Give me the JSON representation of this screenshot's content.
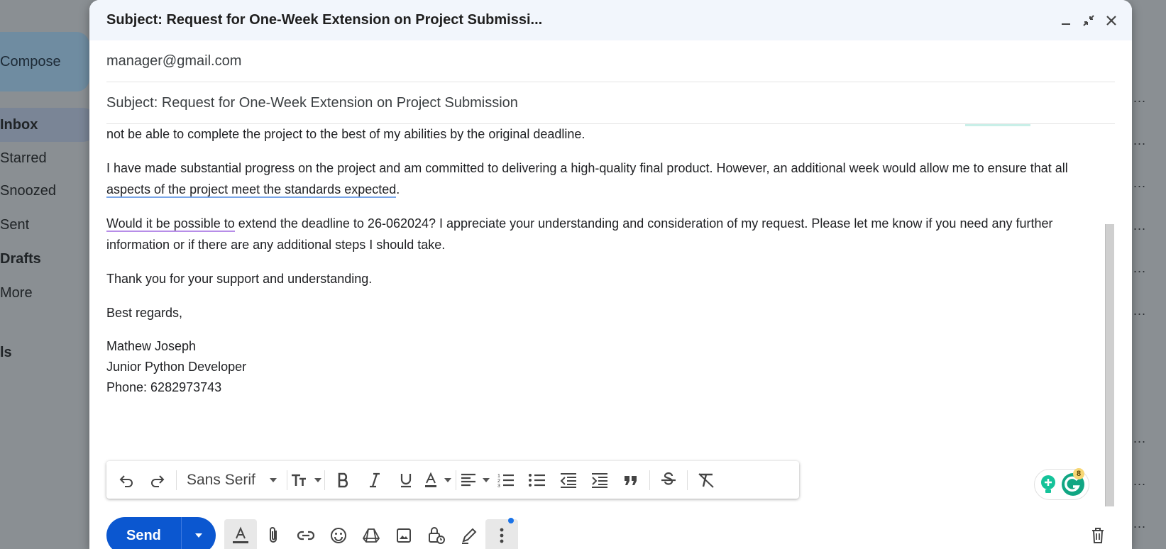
{
  "background": {
    "compose_label": "Compose",
    "nav": [
      {
        "label": "Inbox",
        "active": true
      },
      {
        "label": "Starred"
      },
      {
        "label": "Snoozed"
      },
      {
        "label": "Sent"
      },
      {
        "label": "Drafts",
        "bold": true
      },
      {
        "label": "More"
      },
      {
        "label": "ls"
      }
    ],
    "row_more_glyph": "..."
  },
  "compose": {
    "window_title": "Subject: Request for One-Week Extension on Project Submissi...",
    "to": "manager@gmail.com",
    "subject": "Subject: Request for One-Week Extension on Project Submission",
    "body": {
      "p1": "not be able to complete the project to the best of my abilities by the original deadline.",
      "p2_start": "I have made substantial progress on the project and am committed to delivering a high-quality final product. However, an additional week would allow me to ensure that all ",
      "p2_underlined": "aspects of the project meet the standards expected",
      "p2_end": ".",
      "p3_underlined": "Would it be possible to",
      "p3_rest": " extend the deadline to 26-062024? I appreciate your understanding and consideration of my request. Please let me know if you need any further information or if there are any additional steps I should take.",
      "p4": "Thank you for your support and understanding.",
      "p5": "Best regards,",
      "sig_name": "Mathew Joseph",
      "sig_title": "Junior Python Developer",
      "sig_phone": "Phone: 6282973743"
    },
    "toolbar": {
      "font_name": "Sans Serif"
    },
    "grammarly_count": "8",
    "send_label": "Send"
  },
  "colors": {
    "send": "#0b57d0",
    "title_bar": "#f2f6fc",
    "underline_blue": "#7aa6e8",
    "underline_purple": "#b78de8"
  }
}
